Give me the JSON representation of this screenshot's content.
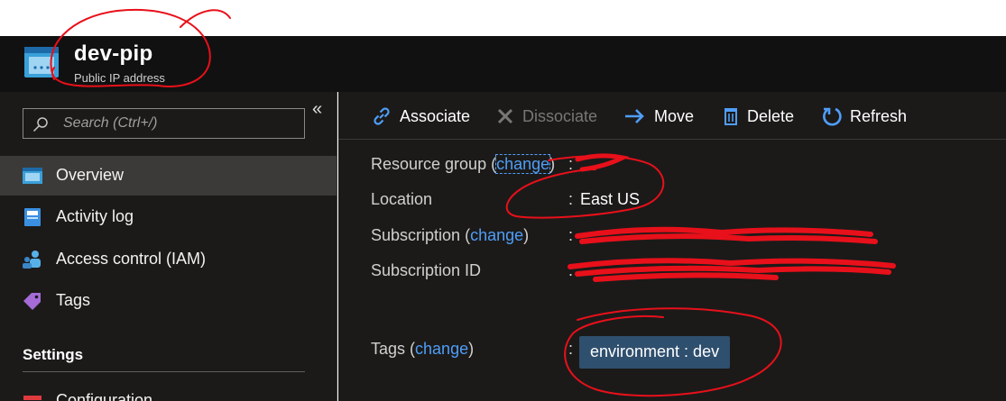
{
  "resource": {
    "name": "dev-pip",
    "type": "Public IP address",
    "icon": "public-ip-address-icon"
  },
  "sidebar": {
    "search_placeholder": "Search (Ctrl+/)",
    "collapse_glyph": "«",
    "items": [
      {
        "label": "Overview",
        "icon": "overview-icon",
        "active": true
      },
      {
        "label": "Activity log",
        "icon": "activity-log-icon"
      },
      {
        "label": "Access control (IAM)",
        "icon": "access-control-icon"
      },
      {
        "label": "Tags",
        "icon": "tag-icon"
      }
    ],
    "section_settings": "Settings",
    "settings_items": [
      {
        "label": "Configuration",
        "icon": "configuration-icon"
      }
    ]
  },
  "toolbar": {
    "associate": "Associate",
    "dissociate": "Dissociate",
    "move": "Move",
    "delete": "Delete",
    "refresh": "Refresh"
  },
  "essentials": {
    "resource_group_label": "Resource group",
    "location_label": "Location",
    "location_value": "East US",
    "subscription_label": "Subscription",
    "subscription_id_label": "Subscription ID",
    "tags_label": "Tags",
    "change_link": "change",
    "colon": ":",
    "tag_value": "environment : dev"
  },
  "colors": {
    "header_bg": "#111111",
    "panel_bg": "#1b1a19",
    "active_item_bg": "#3b3a39",
    "link": "#4f9ef8",
    "tag_chip_bg": "#2f4f6e",
    "annotation": "#e8101a"
  }
}
